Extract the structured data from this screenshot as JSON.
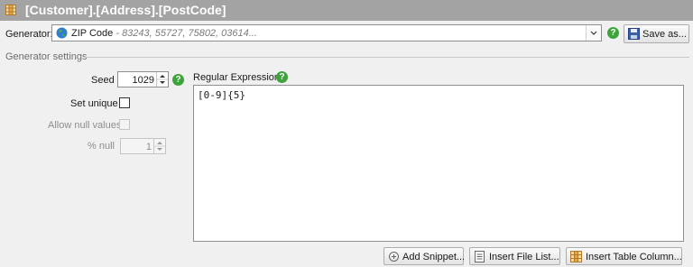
{
  "title": "[Customer].[Address].[PostCode]",
  "generator": {
    "label": "Generator:",
    "selected_name": "ZIP Code",
    "selected_hint": "- 83243, 55727, 75802, 03614...",
    "save_as_label": "Save as..."
  },
  "settings": {
    "group_label": "Generator settings",
    "seed_label": "Seed",
    "seed_value": "1029",
    "set_unique_label": "Set unique",
    "set_unique_checked": false,
    "allow_null_label": "Allow null values",
    "allow_null_checked": false,
    "pct_null_label": "% null",
    "pct_null_value": "1"
  },
  "regex": {
    "label": "Regular Expression:",
    "value": "[0-9]{5}"
  },
  "buttons": {
    "add_snippet": "Add Snippet...",
    "insert_file_list": "Insert File List...",
    "insert_table_column": "Insert Table  Column..."
  },
  "colors": {
    "titlebar": "#a3a3a3",
    "help_green": "#3ea33a",
    "window_bg": "#f0f0f0"
  }
}
